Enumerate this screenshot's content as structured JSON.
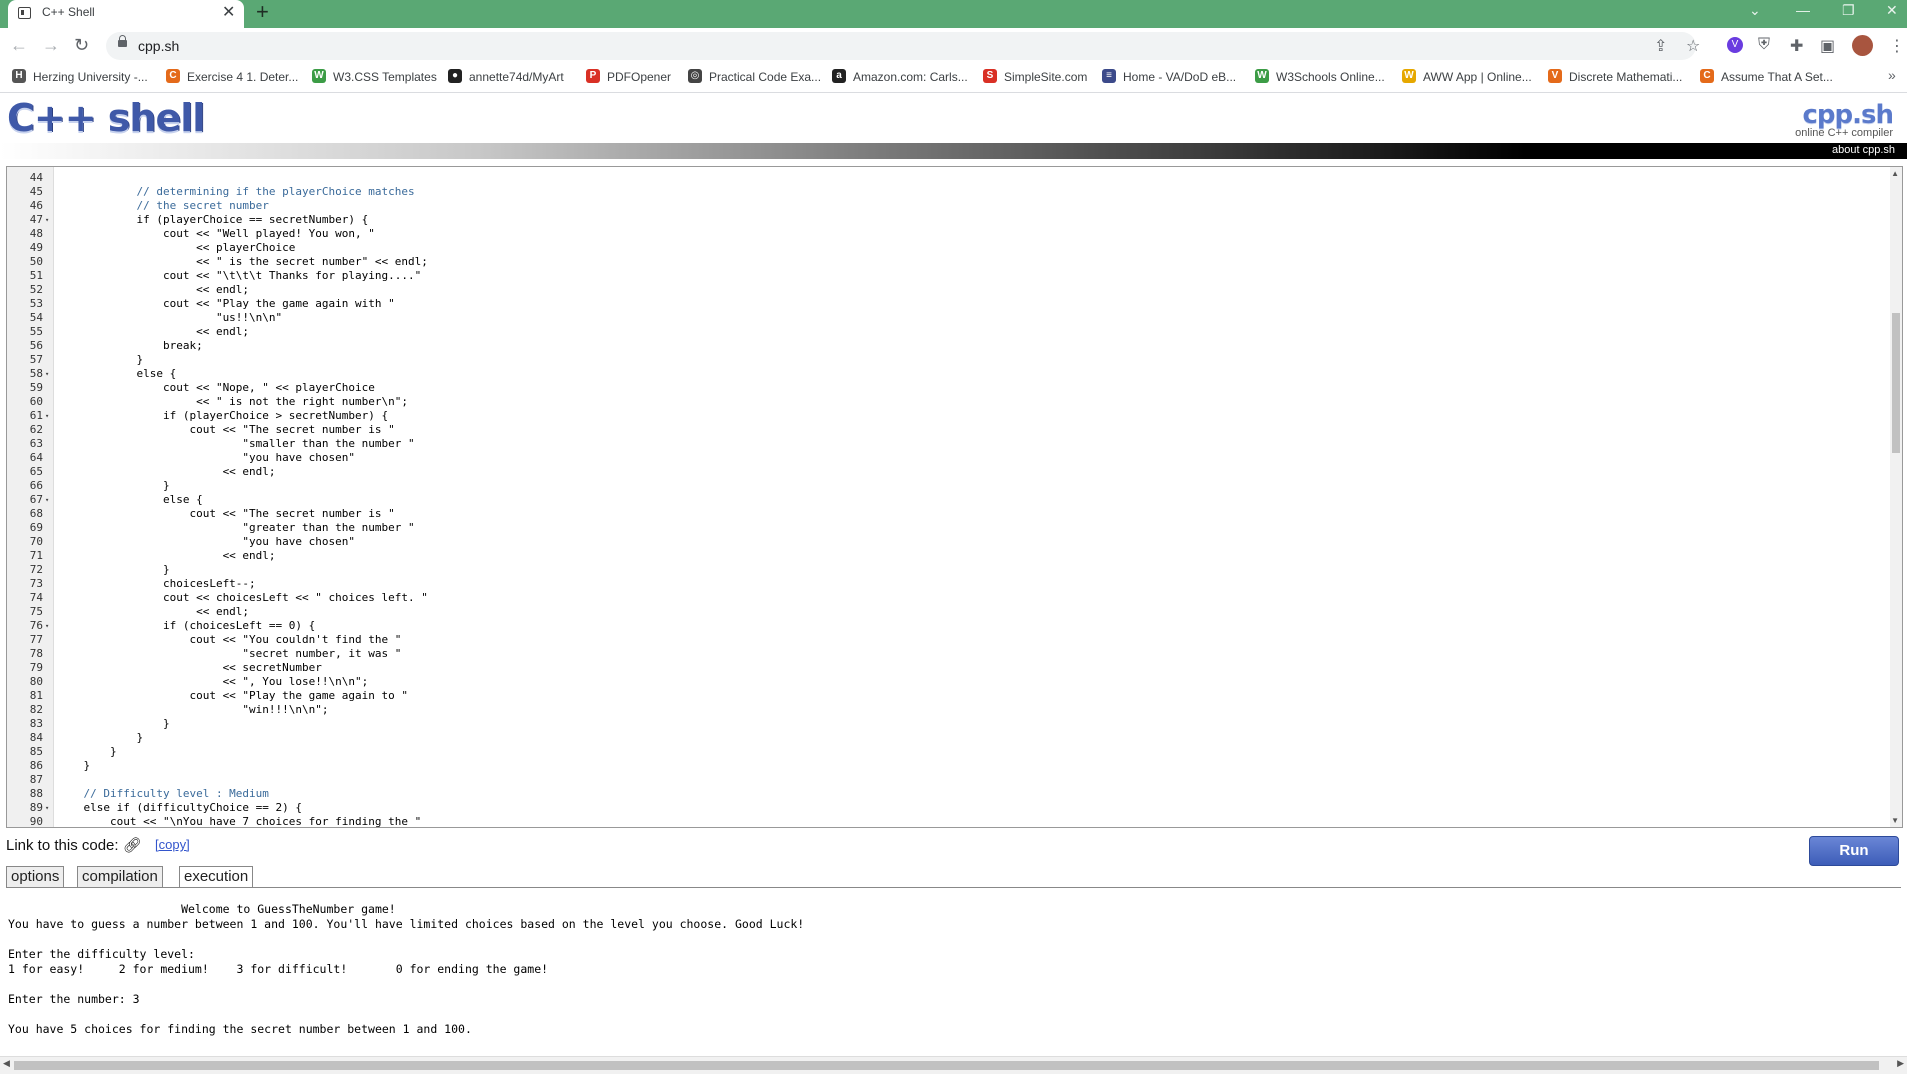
{
  "browser": {
    "tab_title": "C++ Shell",
    "tab_close": "✕",
    "new_tab": "+",
    "url": "cpp.sh",
    "bookmarks": [
      {
        "label": "Herzing University -...",
        "icon": "H",
        "color": "#555555"
      },
      {
        "label": "Exercise 4 1. Deter...",
        "icon": "C",
        "color": "#e46a1a"
      },
      {
        "label": "W3.CSS Templates",
        "icon": "W",
        "color": "#3c9c46"
      },
      {
        "label": "annette74d/MyArt",
        "icon": "●",
        "color": "#222222"
      },
      {
        "label": "PDFOpener",
        "icon": "P",
        "color": "#d93025"
      },
      {
        "label": "Practical Code Exa...",
        "icon": "◎",
        "color": "#444444"
      },
      {
        "label": "Amazon.com: Carls...",
        "icon": "a",
        "color": "#222222"
      },
      {
        "label": "SimpleSite.com",
        "icon": "S",
        "color": "#d93025"
      },
      {
        "label": "Home - VA/DoD eB...",
        "icon": "≡",
        "color": "#3c4a8a"
      },
      {
        "label": "W3Schools Online...",
        "icon": "W",
        "color": "#3c9c46"
      },
      {
        "label": "AWW App | Online...",
        "icon": "W",
        "color": "#e6a800"
      },
      {
        "label": "Discrete Mathemati...",
        "icon": "V",
        "color": "#e46a1a"
      },
      {
        "label": "Assume That A Set...",
        "icon": "C",
        "color": "#e46a1a"
      }
    ]
  },
  "page": {
    "logo": "C++ shell",
    "brand": "cpp.sh",
    "brand_sub": "online C++ compiler",
    "about": "about cpp.sh",
    "link_label": "Link to this code:",
    "copy_label": "[copy]",
    "run_label": "Run",
    "tabs": [
      "options",
      "compilation",
      "execution"
    ]
  },
  "code": [
    {
      "n": "44",
      "f": "",
      "t": ""
    },
    {
      "n": "45",
      "f": "",
      "t": "            // determining if the playerChoice matches"
    },
    {
      "n": "46",
      "f": "",
      "t": "            // the secret number"
    },
    {
      "n": "47",
      "f": "▾",
      "t": "            if (playerChoice == secretNumber) {"
    },
    {
      "n": "48",
      "f": "",
      "t": "                cout << \"Well played! You won, \""
    },
    {
      "n": "49",
      "f": "",
      "t": "                     << playerChoice"
    },
    {
      "n": "50",
      "f": "",
      "t": "                     << \" is the secret number\" << endl;"
    },
    {
      "n": "51",
      "f": "",
      "t": "                cout << \"\\t\\t\\t Thanks for playing....\""
    },
    {
      "n": "52",
      "f": "",
      "t": "                     << endl;"
    },
    {
      "n": "53",
      "f": "",
      "t": "                cout << \"Play the game again with \""
    },
    {
      "n": "54",
      "f": "",
      "t": "                        \"us!!\\n\\n\""
    },
    {
      "n": "55",
      "f": "",
      "t": "                     << endl;"
    },
    {
      "n": "56",
      "f": "",
      "t": "                break;"
    },
    {
      "n": "57",
      "f": "",
      "t": "            }"
    },
    {
      "n": "58",
      "f": "▾",
      "t": "            else {"
    },
    {
      "n": "59",
      "f": "",
      "t": "                cout << \"Nope, \" << playerChoice"
    },
    {
      "n": "60",
      "f": "",
      "t": "                     << \" is not the right number\\n\";"
    },
    {
      "n": "61",
      "f": "▾",
      "t": "                if (playerChoice > secretNumber) {"
    },
    {
      "n": "62",
      "f": "",
      "t": "                    cout << \"The secret number is \""
    },
    {
      "n": "63",
      "f": "",
      "t": "                            \"smaller than the number \""
    },
    {
      "n": "64",
      "f": "",
      "t": "                            \"you have chosen\""
    },
    {
      "n": "65",
      "f": "",
      "t": "                         << endl;"
    },
    {
      "n": "66",
      "f": "",
      "t": "                }"
    },
    {
      "n": "67",
      "f": "▾",
      "t": "                else {"
    },
    {
      "n": "68",
      "f": "",
      "t": "                    cout << \"The secret number is \""
    },
    {
      "n": "69",
      "f": "",
      "t": "                            \"greater than the number \""
    },
    {
      "n": "70",
      "f": "",
      "t": "                            \"you have chosen\""
    },
    {
      "n": "71",
      "f": "",
      "t": "                         << endl;"
    },
    {
      "n": "72",
      "f": "",
      "t": "                }"
    },
    {
      "n": "73",
      "f": "",
      "t": "                choicesLeft--;"
    },
    {
      "n": "74",
      "f": "",
      "t": "                cout << choicesLeft << \" choices left. \""
    },
    {
      "n": "75",
      "f": "",
      "t": "                     << endl;"
    },
    {
      "n": "76",
      "f": "▾",
      "t": "                if (choicesLeft == 0) {"
    },
    {
      "n": "77",
      "f": "",
      "t": "                    cout << \"You couldn't find the \""
    },
    {
      "n": "78",
      "f": "",
      "t": "                            \"secret number, it was \""
    },
    {
      "n": "79",
      "f": "",
      "t": "                         << secretNumber"
    },
    {
      "n": "80",
      "f": "",
      "t": "                         << \", You lose!!\\n\\n\";"
    },
    {
      "n": "81",
      "f": "",
      "t": "                    cout << \"Play the game again to \""
    },
    {
      "n": "82",
      "f": "",
      "t": "                            \"win!!!\\n\\n\";"
    },
    {
      "n": "83",
      "f": "",
      "t": "                }"
    },
    {
      "n": "84",
      "f": "",
      "t": "            }"
    },
    {
      "n": "85",
      "f": "",
      "t": "        }"
    },
    {
      "n": "86",
      "f": "",
      "t": "    }"
    },
    {
      "n": "87",
      "f": "",
      "t": ""
    },
    {
      "n": "88",
      "f": "",
      "t": "    // Difficulty level : Medium"
    },
    {
      "n": "89",
      "f": "▾",
      "t": "    else if (difficultyChoice == 2) {"
    },
    {
      "n": "90",
      "f": "",
      "t": "        cout << \"\\nYou have 7 choices for finding the \""
    }
  ],
  "output": [
    "                         Welcome to GuessTheNumber game!",
    "You have to guess a number between 1 and 100. You'll have limited choices based on the level you choose. Good Luck!",
    "",
    "Enter the difficulty level:",
    "1 for easy!     2 for medium!    3 for difficult!       0 for ending the game!",
    "",
    "Enter the number: 3",
    "",
    "You have 5 choices for finding the secret number between 1 and 100."
  ]
}
